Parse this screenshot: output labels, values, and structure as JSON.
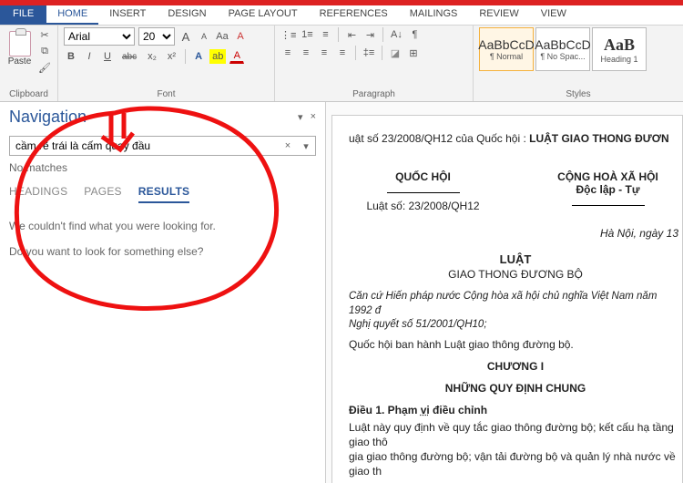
{
  "tabs": {
    "file": "FILE",
    "items": [
      "HOME",
      "INSERT",
      "DESIGN",
      "PAGE LAYOUT",
      "REFERENCES",
      "MAILINGS",
      "REVIEW",
      "VIEW"
    ],
    "active": "HOME"
  },
  "ribbon": {
    "clipboard": {
      "paste": "Paste",
      "label": "Clipboard"
    },
    "font": {
      "name": "Arial",
      "size": "20",
      "grow": "A",
      "shrink": "A",
      "case": "Aa",
      "clear": "A",
      "bold": "B",
      "italic": "I",
      "underline": "U",
      "strike": "abc",
      "sub": "x₂",
      "sup": "x²",
      "effects": "A",
      "highlight": "ab",
      "color": "A",
      "label": "Font"
    },
    "paragraph": {
      "label": "Paragraph"
    },
    "styles": {
      "s1": {
        "sample": "AaBbCcD",
        "name": "¶ Normal"
      },
      "s2": {
        "sample": "AaBbCcD",
        "name": "¶ No Spac..."
      },
      "s3": {
        "sample": "AaB",
        "name": "Heading 1"
      },
      "label": "Styles"
    }
  },
  "nav": {
    "title": "Navigation",
    "dropdown": "▾",
    "close": "×",
    "search_value": "cầm rẽ trái là cấm quay đầu",
    "clear": "×",
    "dd": "▾",
    "nomatch": "No matches",
    "tabs": {
      "headings": "HEADINGS",
      "pages": "PAGES",
      "results": "RESULTS"
    },
    "msg1": "We couldn't find what you were looking for.",
    "msg2": "Do you want to look for something else?"
  },
  "doc": {
    "title_prefix": "uật số 23/2008/QH12 của Quốc hội : ",
    "title_bold": "LUẬT GIAO THONG ĐƯƠN",
    "col1_h": "QUỐC HỘI",
    "col1_sub": "Luật số: 23/2008/QH12",
    "col2_h": "CỘNG HOÀ XÃ HỘI",
    "col2_sub": "Độc lập - Tự",
    "hanoi": "Hà Nội, ngày 13 ",
    "luat": "LUẬT",
    "gtdb": "GIAO THONG ĐƯƠNG BỘ",
    "can1": "Căn cứ Hiến pháp nước Cộng hòa xã hội chủ nghĩa Việt Nam năm 1992 đ",
    "can2": "Nghị quyết số 51/2001/QH10;",
    "qh": "Quốc hội ban hành Luật giao thông đường bộ.",
    "chuong": "CHƯƠNG I",
    "chuong_t": "NHỮNG QUY ĐỊNH CHUNG",
    "d1_a": "Điều 1. Phạm ",
    "d1_u": "vi",
    "d1_b": " điều chỉnh",
    "body1": "Luật này quy định về quy tắc giao thông đường bộ; kết cấu hạ tầng giao thô",
    "body2": "gia giao thông đường bộ; vận tải đường bộ và quản lý nhà nước về giao th"
  }
}
